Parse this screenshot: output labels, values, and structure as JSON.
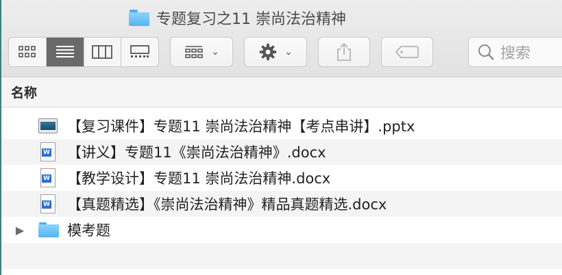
{
  "window": {
    "title": "专题复习之11  崇尚法治精神"
  },
  "toolbar": {
    "view_modes": [
      {
        "name": "icon-view",
        "icon": "grid-icon",
        "active": false
      },
      {
        "name": "list-view",
        "icon": "list-icon",
        "active": true
      },
      {
        "name": "column-view",
        "icon": "columns-icon",
        "active": false
      },
      {
        "name": "gallery-view",
        "icon": "gallery-icon",
        "active": false
      }
    ],
    "group_icon": "group-grid-icon",
    "action_icon": "gear-icon",
    "share_icon": "share-icon",
    "tag_icon": "tag-icon",
    "search_placeholder": "搜索"
  },
  "columns": {
    "name_header": "名称"
  },
  "files": [
    {
      "name": "【复习课件】专题11 崇尚法治精神【考点串讲】.pptx",
      "type": "pptx"
    },
    {
      "name": "【讲义】专题11《崇尚法治精神》.docx",
      "type": "docx"
    },
    {
      "name": "【教学设计】专题11 崇尚法治精神.docx",
      "type": "docx"
    },
    {
      "name": "【真题精选】《崇尚法治精神》精品真题精选.docx",
      "type": "docx"
    },
    {
      "name": "模考题",
      "type": "folder",
      "collapsed": true
    }
  ],
  "colors": {
    "window_border": "#3e7f78",
    "active_segment": "#6a6a6a",
    "folder_blue": "#55b5ee",
    "word_blue": "#2b6fd6"
  }
}
